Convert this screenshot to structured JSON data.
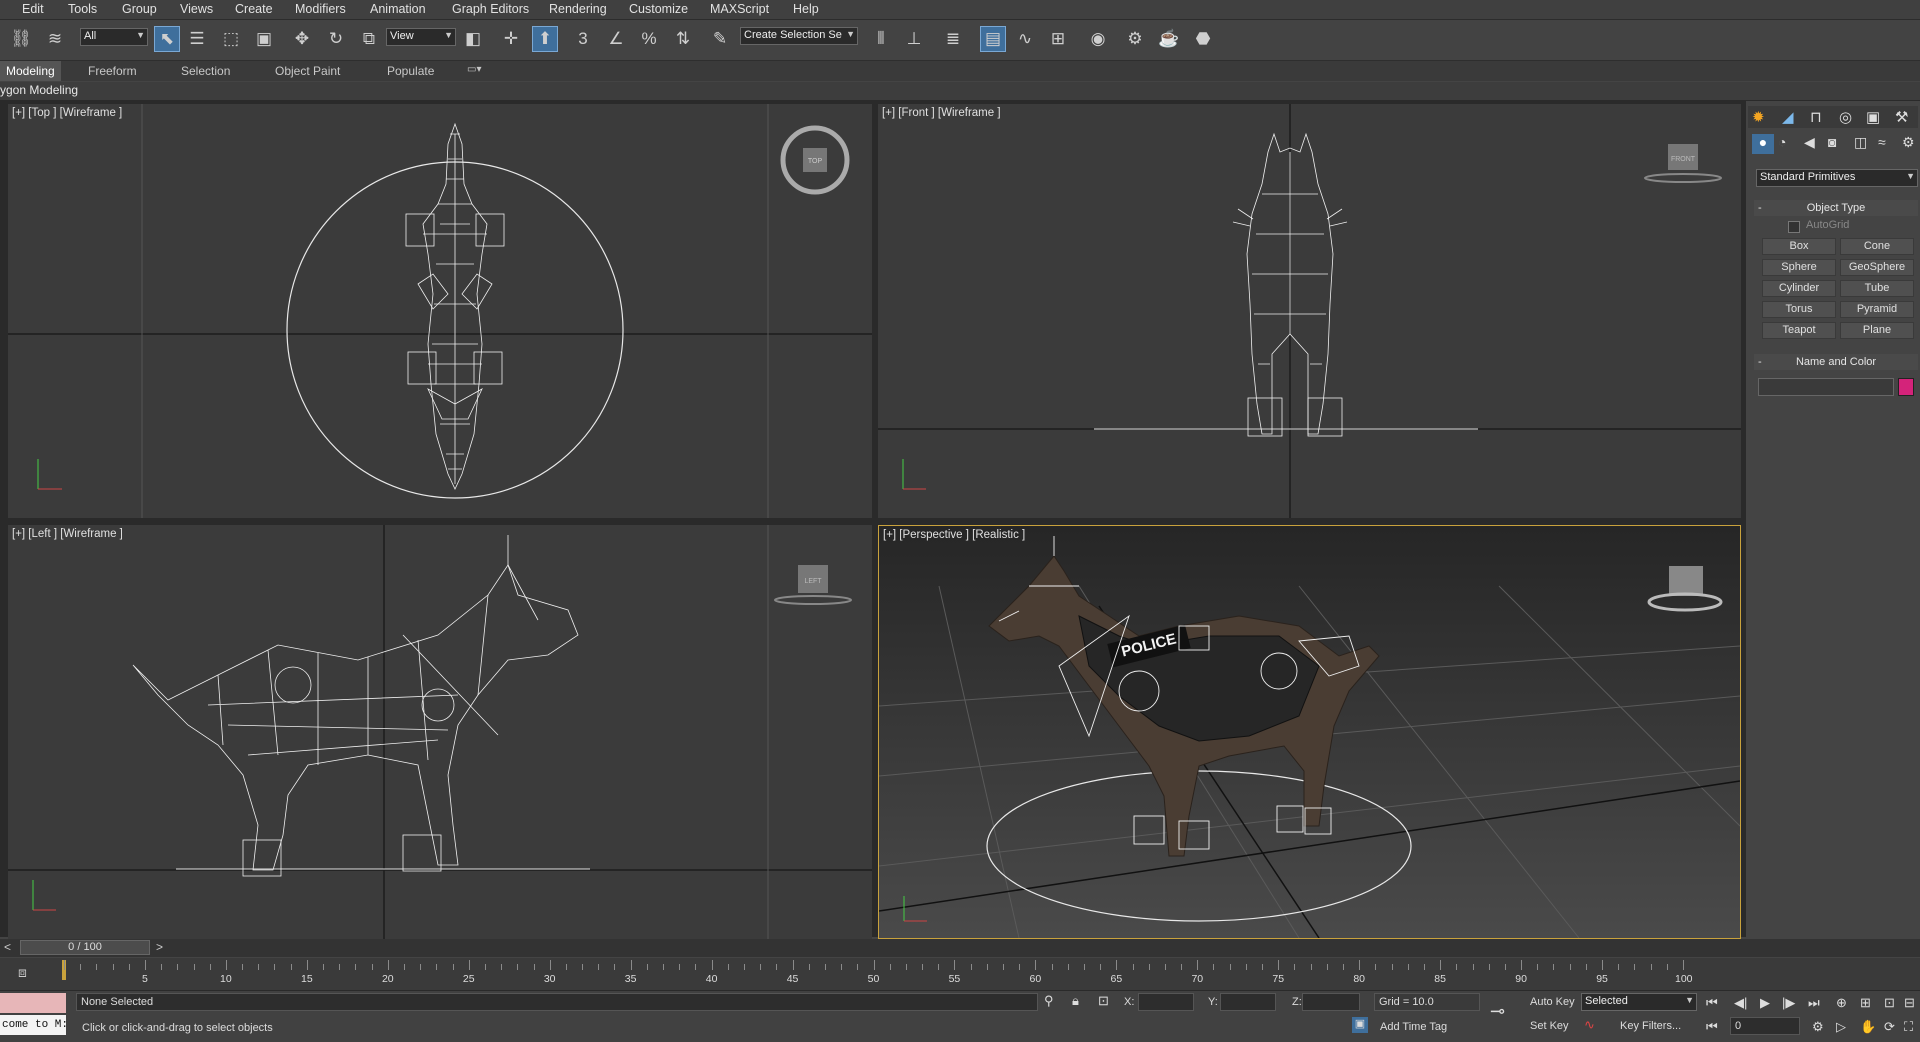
{
  "menu": [
    "Edit",
    "Tools",
    "Group",
    "Views",
    "Create",
    "Modifiers",
    "Animation",
    "Graph Editors",
    "Rendering",
    "Customize",
    "MAXScript",
    "Help"
  ],
  "toolbar": {
    "selection_filter": "All",
    "ref_coord": "View",
    "named_selection": "Create Selection Se",
    "snap_labels": [
      "3",
      "%"
    ]
  },
  "ribbon": {
    "tabs": [
      "Modeling",
      "Freeform",
      "Selection",
      "Object Paint",
      "Populate"
    ],
    "sub_label": "ygon Modeling"
  },
  "viewports": {
    "top": "[+] [Top ] [Wireframe ]",
    "front": "[+] [Front ] [Wireframe ]",
    "left": "[+] [Left ] [Wireframe ]",
    "perspective": "[+] [Perspective ] [Realistic ]",
    "viewcube": {
      "top": "TOP",
      "front": "FRONT",
      "left": "LEFT"
    },
    "vest_text": "POLICE"
  },
  "command_panel": {
    "category": "Standard Primitives",
    "object_type_title": "Object Type",
    "autogrid": "AutoGrid",
    "buttons": [
      "Box",
      "Cone",
      "Sphere",
      "GeoSphere",
      "Cylinder",
      "Tube",
      "Torus",
      "Pyramid",
      "Teapot",
      "Plane"
    ],
    "name_color_title": "Name and Color",
    "color_swatch": "#d4237a"
  },
  "timeline": {
    "frame_counter": "0 / 100",
    "ticks": [
      "5",
      "10",
      "15",
      "20",
      "25",
      "30",
      "35",
      "40",
      "45",
      "50",
      "55",
      "60",
      "65",
      "70",
      "75",
      "80",
      "85",
      "90",
      "95",
      "100"
    ]
  },
  "status": {
    "maxscript_listener": "come to M:",
    "selection_status": "None Selected",
    "prompt": "Click or click-and-drag to select objects",
    "x_label": "X:",
    "y_label": "Y:",
    "z_label": "Z:",
    "grid": "Grid = 10.0",
    "add_time_tag": "Add Time Tag",
    "auto_key": "Auto Key",
    "set_key": "Set Key",
    "selected_dropdown": "Selected",
    "key_filters": "Key Filters...",
    "current_frame": "0"
  }
}
